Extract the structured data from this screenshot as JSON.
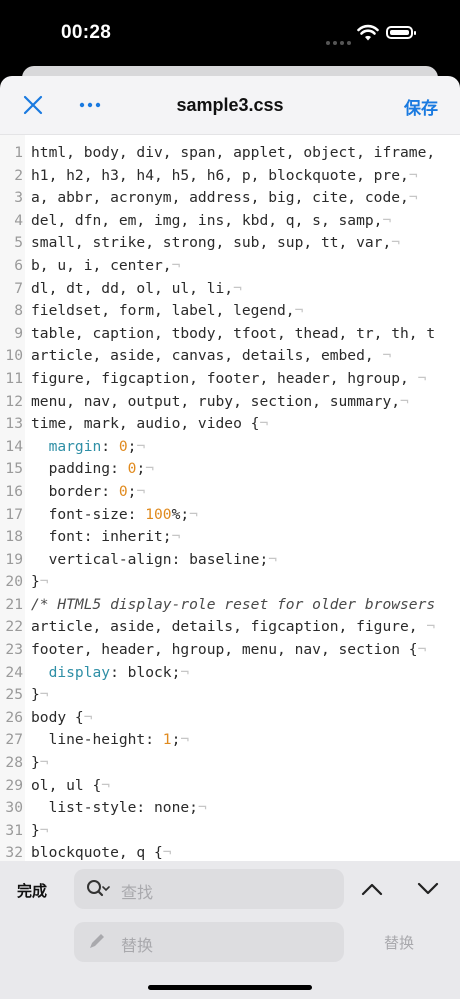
{
  "status_bar": {
    "time": "00:28"
  },
  "nav": {
    "title": "sample3.css",
    "save_label": "保存"
  },
  "editor": {
    "lines": [
      {
        "n": "1",
        "parts": [
          {
            "t": "html, body, div, span, applet, object, iframe,",
            "c": ""
          }
        ]
      },
      {
        "n": "2",
        "parts": [
          {
            "t": "h1, h2, h3, h4, h5, h6, p, blockquote, pre,",
            "c": ""
          },
          {
            "t": "¬",
            "c": "eol"
          }
        ]
      },
      {
        "n": "3",
        "parts": [
          {
            "t": "a, abbr, acronym, address, big, cite, code,",
            "c": ""
          },
          {
            "t": "¬",
            "c": "eol"
          }
        ]
      },
      {
        "n": "4",
        "parts": [
          {
            "t": "del, dfn, em, img, ins, kbd, q, s, samp,",
            "c": ""
          },
          {
            "t": "¬",
            "c": "eol"
          }
        ]
      },
      {
        "n": "5",
        "parts": [
          {
            "t": "small, strike, strong, sub, sup, tt, var,",
            "c": ""
          },
          {
            "t": "¬",
            "c": "eol"
          }
        ]
      },
      {
        "n": "6",
        "parts": [
          {
            "t": "b, u, i, center,",
            "c": ""
          },
          {
            "t": "¬",
            "c": "eol"
          }
        ]
      },
      {
        "n": "7",
        "parts": [
          {
            "t": "dl, dt, dd, ol, ul, li,",
            "c": ""
          },
          {
            "t": "¬",
            "c": "eol"
          }
        ]
      },
      {
        "n": "8",
        "parts": [
          {
            "t": "fieldset, form, label, legend,",
            "c": ""
          },
          {
            "t": "¬",
            "c": "eol"
          }
        ]
      },
      {
        "n": "9",
        "parts": [
          {
            "t": "table, caption, tbody, tfoot, thead, tr, th, t",
            "c": ""
          }
        ]
      },
      {
        "n": "10",
        "parts": [
          {
            "t": "article, aside, canvas, details, embed,",
            "c": ""
          },
          {
            "t": " ¬",
            "c": "eol"
          }
        ]
      },
      {
        "n": "11",
        "parts": [
          {
            "t": "figure, figcaption, footer, header, hgroup,",
            "c": ""
          },
          {
            "t": " ¬",
            "c": "eol"
          }
        ]
      },
      {
        "n": "12",
        "parts": [
          {
            "t": "menu, nav, output, ruby, section, summary,",
            "c": ""
          },
          {
            "t": "¬",
            "c": "eol"
          }
        ]
      },
      {
        "n": "13",
        "parts": [
          {
            "t": "time, mark, audio, video {",
            "c": ""
          },
          {
            "t": "¬",
            "c": "eol"
          }
        ]
      },
      {
        "n": "14",
        "parts": [
          {
            "t": "  ",
            "c": ""
          },
          {
            "t": "margin",
            "c": "kw"
          },
          {
            "t": ": ",
            "c": ""
          },
          {
            "t": "0",
            "c": "num"
          },
          {
            "t": ";",
            "c": ""
          },
          {
            "t": "¬",
            "c": "eol"
          }
        ]
      },
      {
        "n": "15",
        "parts": [
          {
            "t": "  padding: ",
            "c": ""
          },
          {
            "t": "0",
            "c": "num"
          },
          {
            "t": ";",
            "c": ""
          },
          {
            "t": "¬",
            "c": "eol"
          }
        ]
      },
      {
        "n": "16",
        "parts": [
          {
            "t": "  border: ",
            "c": ""
          },
          {
            "t": "0",
            "c": "num"
          },
          {
            "t": ";",
            "c": ""
          },
          {
            "t": "¬",
            "c": "eol"
          }
        ]
      },
      {
        "n": "17",
        "parts": [
          {
            "t": "  font-size: ",
            "c": ""
          },
          {
            "t": "100",
            "c": "num"
          },
          {
            "t": "%;",
            "c": ""
          },
          {
            "t": "¬",
            "c": "eol"
          }
        ]
      },
      {
        "n": "18",
        "parts": [
          {
            "t": "  font: inherit;",
            "c": ""
          },
          {
            "t": "¬",
            "c": "eol"
          }
        ]
      },
      {
        "n": "19",
        "parts": [
          {
            "t": "  vertical-align: baseline;",
            "c": ""
          },
          {
            "t": "¬",
            "c": "eol"
          }
        ]
      },
      {
        "n": "20",
        "parts": [
          {
            "t": "}",
            "c": ""
          },
          {
            "t": "¬",
            "c": "eol"
          }
        ]
      },
      {
        "n": "21",
        "parts": [
          {
            "t": "/* HTML5 display-role reset for older browsers",
            "c": "cm"
          }
        ]
      },
      {
        "n": "22",
        "parts": [
          {
            "t": "article, aside, details, figcaption, figure,",
            "c": ""
          },
          {
            "t": " ¬",
            "c": "eol"
          }
        ]
      },
      {
        "n": "23",
        "parts": [
          {
            "t": "footer, header, hgroup, menu, nav, section {",
            "c": ""
          },
          {
            "t": "¬",
            "c": "eol"
          }
        ]
      },
      {
        "n": "24",
        "parts": [
          {
            "t": "  ",
            "c": ""
          },
          {
            "t": "display",
            "c": "kw"
          },
          {
            "t": ": block;",
            "c": ""
          },
          {
            "t": "¬",
            "c": "eol"
          }
        ]
      },
      {
        "n": "25",
        "parts": [
          {
            "t": "}",
            "c": ""
          },
          {
            "t": "¬",
            "c": "eol"
          }
        ]
      },
      {
        "n": "26",
        "parts": [
          {
            "t": "body {",
            "c": ""
          },
          {
            "t": "¬",
            "c": "eol"
          }
        ]
      },
      {
        "n": "27",
        "parts": [
          {
            "t": "  line-height: ",
            "c": ""
          },
          {
            "t": "1",
            "c": "num"
          },
          {
            "t": ";",
            "c": ""
          },
          {
            "t": "¬",
            "c": "eol"
          }
        ]
      },
      {
        "n": "28",
        "parts": [
          {
            "t": "}",
            "c": ""
          },
          {
            "t": "¬",
            "c": "eol"
          }
        ]
      },
      {
        "n": "29",
        "parts": [
          {
            "t": "ol, ul {",
            "c": ""
          },
          {
            "t": "¬",
            "c": "eol"
          }
        ]
      },
      {
        "n": "30",
        "parts": [
          {
            "t": "  list-style: none;",
            "c": ""
          },
          {
            "t": "¬",
            "c": "eol"
          }
        ]
      },
      {
        "n": "31",
        "parts": [
          {
            "t": "}",
            "c": ""
          },
          {
            "t": "¬",
            "c": "eol"
          }
        ]
      },
      {
        "n": "32",
        "parts": [
          {
            "t": "blockquote, q {",
            "c": ""
          },
          {
            "t": "¬",
            "c": "eol"
          }
        ]
      }
    ]
  },
  "find_bar": {
    "done_label": "完成",
    "find_placeholder": "查找",
    "replace_placeholder": "替换",
    "replace_button_label": "替换"
  },
  "colors": {
    "accent": "#1a7ae0",
    "keyword": "#2f8fa6",
    "number": "#e08a1e"
  },
  "icons": [
    "close-icon",
    "more-icon",
    "search-icon",
    "pencil-icon",
    "chevron-up-icon",
    "chevron-down-icon",
    "wifi-icon",
    "battery-icon"
  ]
}
